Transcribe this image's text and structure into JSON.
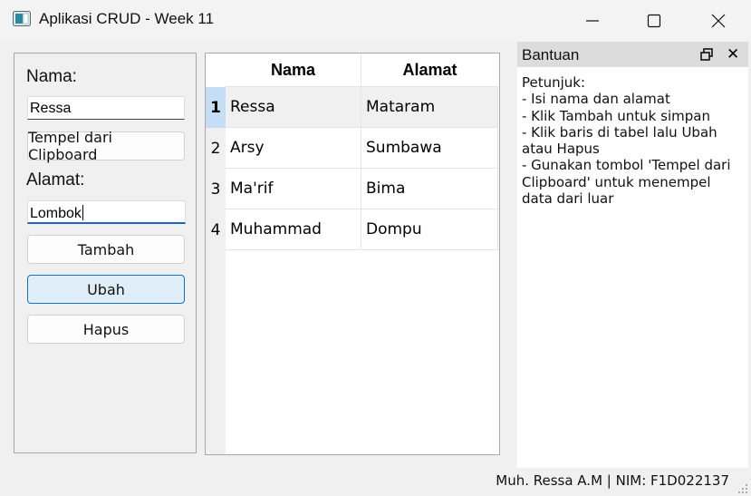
{
  "window": {
    "title": "Aplikasi CRUD - Week 11"
  },
  "form": {
    "nama_label": "Nama:",
    "nama_value": "Ressa",
    "paste_button": "Tempel dari Clipboard",
    "alamat_label": "Alamat:",
    "alamat_value": "Lombok",
    "add_button": "Tambah",
    "update_button": "Ubah",
    "delete_button": "Hapus"
  },
  "table": {
    "headers": [
      "Nama",
      "Alamat"
    ],
    "rows": [
      {
        "num": "1",
        "nama": "Ressa",
        "alamat": "Mataram"
      },
      {
        "num": "2",
        "nama": "Arsy",
        "alamat": "Sumbawa"
      },
      {
        "num": "3",
        "nama": "Ma'rif",
        "alamat": "Bima"
      },
      {
        "num": "4",
        "nama": "Muhammad",
        "alamat": "Dompu"
      }
    ],
    "selected_row": "1"
  },
  "dock": {
    "title": "Bantuan",
    "lines": [
      "Petunjuk:",
      "- Isi nama dan alamat",
      "- Klik Tambah untuk simpan",
      "- Klik baris di tabel lalu Ubah atau Hapus",
      "- Gunakan tombol 'Tempel dari Clipboard' untuk menempel data dari luar"
    ]
  },
  "status": {
    "text": "Muh. Ressa A.M | NIM: F1D022137"
  },
  "colors": {
    "accent": "#0f73c7",
    "selection": "#c6def5"
  }
}
